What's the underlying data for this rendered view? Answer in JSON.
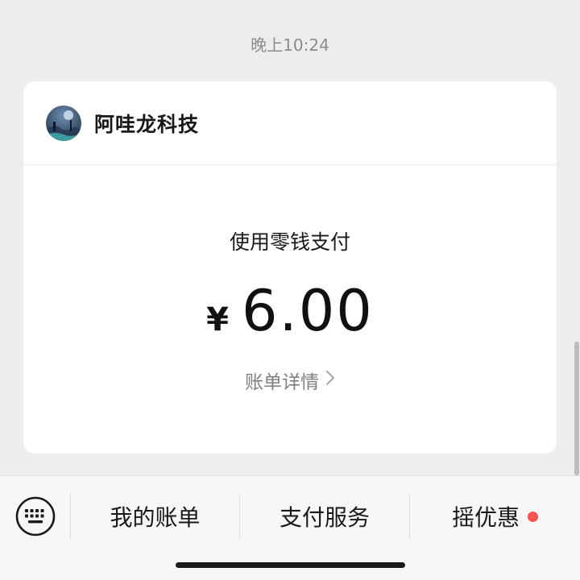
{
  "message": {
    "timestamp": "晚上10:24"
  },
  "payment_card": {
    "merchant_name": "阿哇龙科技",
    "avatar_icon": "merchant-avatar-night-scene",
    "pay_method": "使用零钱支付",
    "currency_symbol": "¥",
    "amount": "6.00",
    "detail_link": "账单详情"
  },
  "bottom_menu": {
    "keyboard_icon": "keyboard-icon",
    "items": [
      {
        "label": "我的账单"
      },
      {
        "label": "支付服务"
      },
      {
        "label": "摇优惠",
        "has_red_dot": true
      }
    ]
  },
  "colors": {
    "background": "#ededed",
    "card": "#ffffff",
    "menu_bar": "#f7f7f7",
    "badge": "#fa5151"
  }
}
